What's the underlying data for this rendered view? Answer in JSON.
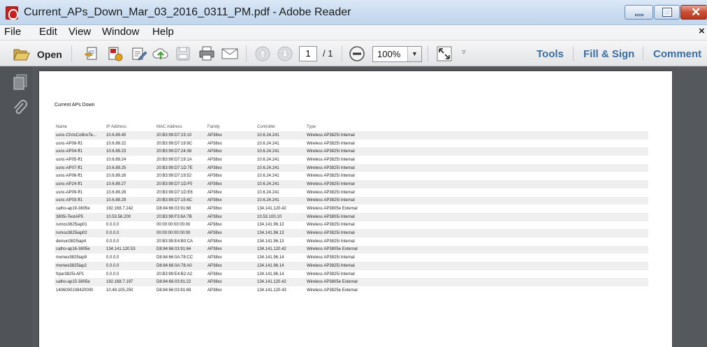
{
  "window": {
    "title": "Current_APs_Down_Mar_03_2016_0311_PM.pdf - Adobe Reader"
  },
  "menu": {
    "items": [
      "File",
      "Edit",
      "View",
      "Window",
      "Help"
    ],
    "close_glyph": "×"
  },
  "toolbar": {
    "open_label": "Open",
    "page_current": "1",
    "page_total": "/ 1",
    "zoom": "100%",
    "links": [
      "Tools",
      "Fill & Sign",
      "Comment"
    ],
    "icons": [
      "open-folder-icon",
      "create-pdf-icon",
      "export-icon",
      "sign-icon",
      "upload-cloud-icon",
      "save-icon",
      "print-icon",
      "email-icon",
      "previous-page-icon",
      "next-page-icon",
      "zoom-out-icon",
      "fullscreen-icon",
      "more-icon"
    ]
  },
  "navpane": {
    "icons": [
      "pages-icon",
      "attachments-icon"
    ]
  },
  "report": {
    "title": "Current APs Down",
    "columns": [
      "Name",
      "IP Address",
      "MAC Address",
      "Family",
      "Controller",
      "Type"
    ],
    "rows": [
      [
        "usnc-ChrisCollinsTe...",
        "10.6.89.45",
        "20:B3:99:D7:23:10",
        "AP38xx",
        "10.6.24.241",
        "Wireless AP3825i Internal"
      ],
      [
        "usnc-AP08-ff1",
        "10.6.89.22",
        "20:B3:99:D7:19:9C",
        "AP38xx",
        "10.6.24.241",
        "Wireless AP3825i Internal"
      ],
      [
        "usnc-AP04-ff1",
        "10.6.89.23",
        "20:B3:99:D7:24:38",
        "AP38xx",
        "10.6.24.241",
        "Wireless AP3825i Internal"
      ],
      [
        "usnc-AP05-ff1",
        "10.6.89.24",
        "20:B3:99:D7:19:1A",
        "AP38xx",
        "10.6.24.241",
        "Wireless AP3825i Internal"
      ],
      [
        "usnc-AP07-ff1",
        "10.6.89.25",
        "20:B3:99:D7:1D:7E",
        "AP38xx",
        "10.6.24.241",
        "Wireless AP3825i Internal"
      ],
      [
        "usnc-AP06-ff1",
        "10.6.89.26",
        "20:B3:99:D7:19:52",
        "AP38xx",
        "10.6.24.241",
        "Wireless AP3825i Internal"
      ],
      [
        "usnc-AP24-ff1",
        "10.6.89.27",
        "20:B3:99:D7:1D:F0",
        "AP38xx",
        "10.6.24.241",
        "Wireless AP3825i Internal"
      ],
      [
        "usnc-AP09-ff1",
        "10.6.89.28",
        "20:B3:99:D7:1D:E6",
        "AP38xx",
        "10.6.24.241",
        "Wireless AP3825i Internal"
      ],
      [
        "usnc-AP03-ff1",
        "10.6.89.29",
        "20:B3:99:D7:15:6C",
        "AP38xx",
        "10.6.24.241",
        "Wireless AP3825i Internal"
      ],
      [
        "catho-ap19-3805e",
        "192.168.7.242",
        "D8:84:66:03:91:68",
        "AP38xx",
        "134.141.120.42",
        "Wireless AP3805e External"
      ],
      [
        "3805i-TestAP5",
        "10.53.56.200",
        "20:B3:99:F3:8A:7B",
        "AP38xx",
        "10.53.100.10",
        "Wireless AP3805i Internal"
      ],
      [
        "rumos3825iap01",
        "0.0.0.0",
        "00:00:00:00:00:00",
        "AP38xx",
        "134.141.96.13",
        "Wireless AP3825i Internal"
      ],
      [
        "rumos3825iap02",
        "0.0.0.0",
        "00:00:00:00:00:00",
        "AP38xx",
        "134.141.96.13",
        "Wireless AP3825i Internal"
      ],
      [
        "demun3825iap4",
        "0.0.0.0",
        "20:B3:99:E4:B0:CA",
        "AP38xx",
        "134.141.96.13",
        "Wireless AP3825i Internal"
      ],
      [
        "catho-ap16-3805e",
        "134.141.120.53",
        "D8:84:66:03:91:64",
        "AP38xx",
        "134.141.120.42",
        "Wireless AP3805e External"
      ],
      [
        "mxmex3825iap9",
        "0.0.0.0",
        "D8:84:66:0A:78:CC",
        "AP38xx",
        "134.141.96.14",
        "Wireless AP3825i Internal"
      ],
      [
        "mxmex3825iap2",
        "0.0.0.0",
        "D8:84:66:0A:78:A0",
        "AP38xx",
        "134.141.96.14",
        "Wireless AP3825i Internal"
      ],
      [
        "frpar3825i-AP1",
        "0.0.0.0",
        "20:B3:99:E4:B2:A2",
        "AP38xx",
        "134.141.96.14",
        "Wireless AP3825i Internal"
      ],
      [
        "catho-ap15-3805e",
        "192.168.7.197",
        "D8:84:66:03:91:22",
        "AP38xx",
        "134.141.120.42",
        "Wireless AP3805e External"
      ],
      [
        "1406000108420000",
        "10.49.105.250",
        "D8:84:66:03:91:69",
        "AP38xx",
        "134.141.120.43",
        "Wireless AP3825e External"
      ]
    ]
  }
}
